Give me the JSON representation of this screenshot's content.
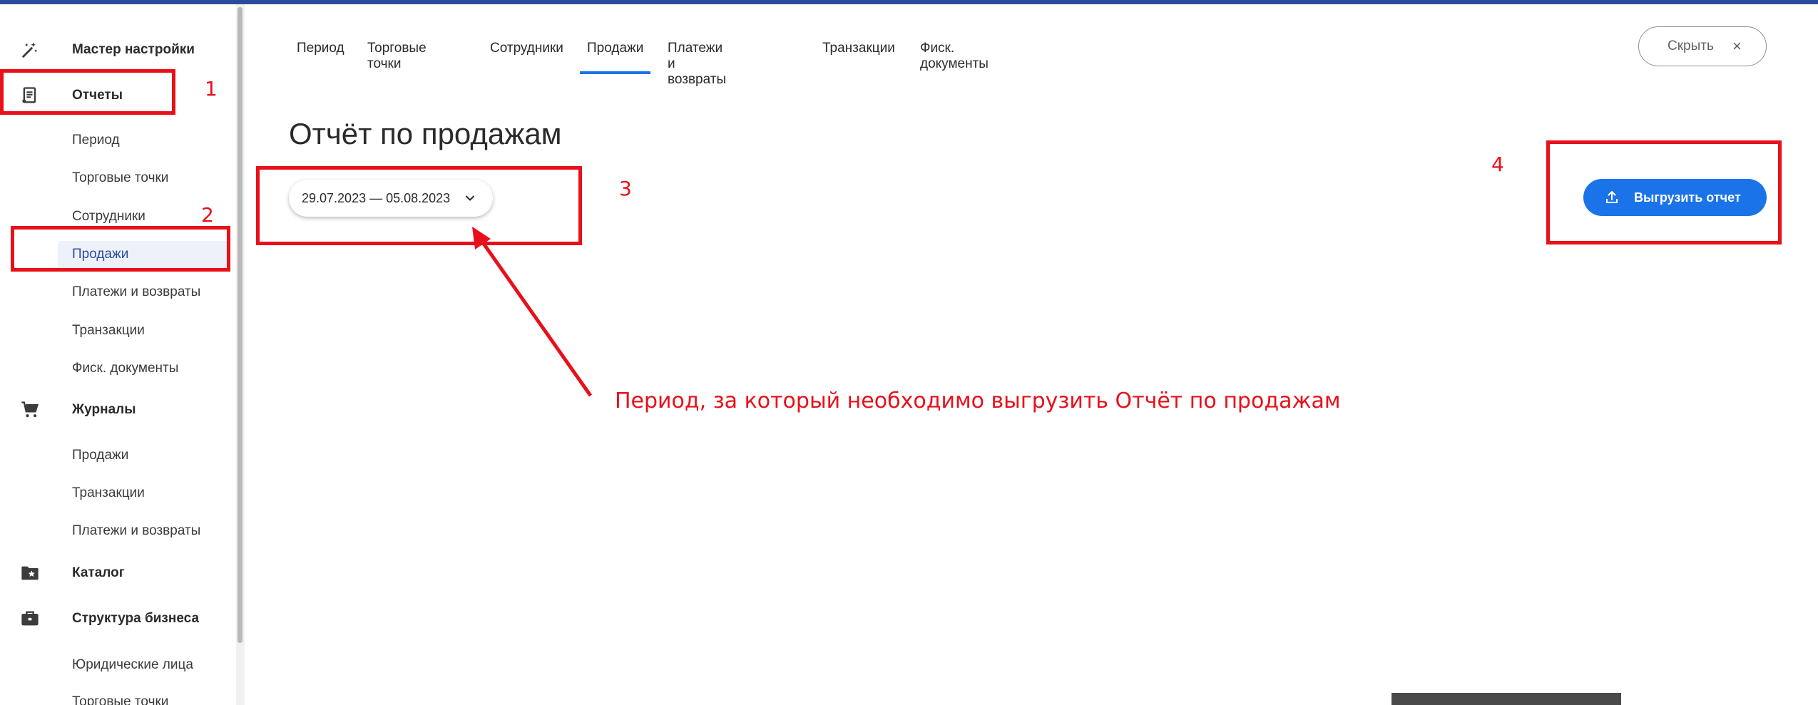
{
  "sidebar": {
    "sections": [
      {
        "label": "Мастер настройки",
        "icon": "magic-wand-icon"
      },
      {
        "label": "Отчеты",
        "icon": "report-icon"
      },
      {
        "label": "Журналы",
        "icon": "cart-icon"
      },
      {
        "label": "Каталог",
        "icon": "star-folder-icon"
      },
      {
        "label": "Структура бизнеса",
        "icon": "briefcase-icon"
      }
    ],
    "reports_items": [
      "Период",
      "Торговые точки",
      "Сотрудники",
      "Продажи",
      "Платежи и возвраты",
      "Транзакции",
      "Фиск. документы"
    ],
    "journals_items": [
      "Продажи",
      "Транзакции",
      "Платежи и возвраты"
    ],
    "business_items": [
      "Юридические лица",
      "Торговые точки"
    ],
    "active_item": "Продажи"
  },
  "tabs": [
    "Период",
    "Торговые точки",
    "Сотрудники",
    "Продажи",
    "Платежи и возвраты",
    "Транзакции",
    "Фиск. документы"
  ],
  "active_tab": "Продажи",
  "hide_button": {
    "label": "Скрыть"
  },
  "page_title": "Отчёт по продажам",
  "date_range": "29.07.2023 — 05.08.2023",
  "export_button": {
    "label": "Выгрузить отчет"
  },
  "annotations": {
    "labels": [
      "1",
      "2",
      "3",
      "4"
    ],
    "text": "Период, за который необходимо выгрузить Отчёт по продажам",
    "color": "#e8101a"
  },
  "colors": {
    "accent": "#1a73e8",
    "active_nav_text": "#2a4d9b",
    "topbar": "#2a4d9b"
  }
}
